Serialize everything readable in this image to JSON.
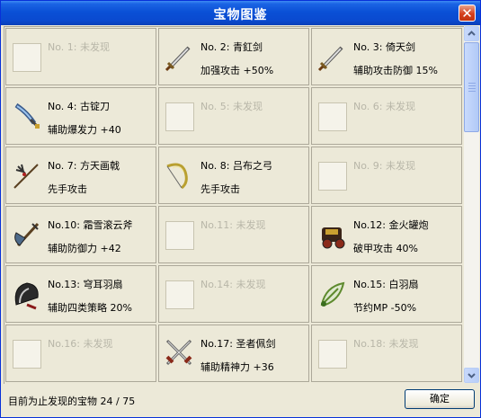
{
  "window": {
    "title": "宝物图鉴",
    "close_label": "✕"
  },
  "items": [
    {
      "name": "No. 1: 未发现",
      "desc": "",
      "found": false,
      "icon": "empty-slot-icon"
    },
    {
      "name": "No. 2: 青釭剑",
      "desc": "加强攻击 +50%",
      "found": true,
      "icon": "sword-icon"
    },
    {
      "name": "No. 3: 倚天剑",
      "desc": "辅助攻击防御 15%",
      "found": true,
      "icon": "sword-icon"
    },
    {
      "name": "No. 4: 古锭刀",
      "desc": "辅助爆发力 +40",
      "found": true,
      "icon": "blade-icon"
    },
    {
      "name": "No. 5: 未发现",
      "desc": "",
      "found": false,
      "icon": "empty-slot-icon"
    },
    {
      "name": "No. 6: 未发现",
      "desc": "",
      "found": false,
      "icon": "empty-slot-icon"
    },
    {
      "name": "No. 7: 方天画戟",
      "desc": "先手攻击",
      "found": true,
      "icon": "halberd-icon"
    },
    {
      "name": "No. 8: 吕布之弓",
      "desc": "先手攻击",
      "found": true,
      "icon": "bow-icon"
    },
    {
      "name": "No. 9: 未发现",
      "desc": "",
      "found": false,
      "icon": "empty-slot-icon"
    },
    {
      "name": "No.10: 霜雪滚云斧",
      "desc": "辅助防御力 +42",
      "found": true,
      "icon": "axe-icon"
    },
    {
      "name": "No.11: 未发现",
      "desc": "",
      "found": false,
      "icon": "empty-slot-icon"
    },
    {
      "name": "No.12: 金火罐炮",
      "desc": "破甲攻击 40%",
      "found": true,
      "icon": "cannon-icon"
    },
    {
      "name": "No.13: 穹耳羽扇",
      "desc": "辅助四类策略 20%",
      "found": true,
      "icon": "fan-icon"
    },
    {
      "name": "No.14: 未发现",
      "desc": "",
      "found": false,
      "icon": "empty-slot-icon"
    },
    {
      "name": "No.15: 白羽扇",
      "desc": "节约MP -50%",
      "found": true,
      "icon": "feather-fan-icon"
    },
    {
      "name": "No.16: 未发现",
      "desc": "",
      "found": false,
      "icon": "empty-slot-icon"
    },
    {
      "name": "No.17: 圣者佩剑",
      "desc": "辅助精神力 +36",
      "found": true,
      "icon": "crossed-swords-icon"
    },
    {
      "name": "No.18: 未发现",
      "desc": "",
      "found": false,
      "icon": "empty-slot-icon"
    }
  ],
  "footer": {
    "status": "目前为止发现的宝物 24 / 75",
    "ok_label": "确定"
  },
  "colors": {
    "title_bar": "#0a50d6",
    "panel": "#ece9d8",
    "disabled_text": "#b8b6a8"
  }
}
